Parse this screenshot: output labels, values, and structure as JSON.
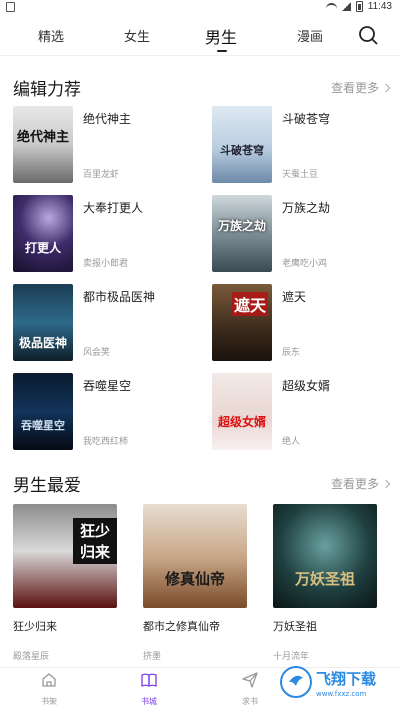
{
  "status_bar": {
    "time": "11:43"
  },
  "tabs": [
    {
      "label": "精选"
    },
    {
      "label": "女生"
    },
    {
      "label": "男生",
      "active": true
    },
    {
      "label": "漫画"
    }
  ],
  "sections": {
    "editor": {
      "title": "编辑力荐",
      "more": "查看更多",
      "books": [
        {
          "title": "绝代神主",
          "author": "百里龙虾",
          "cover_text": "绝代神主"
        },
        {
          "title": "斗破苍穹",
          "author": "天蚕土豆",
          "cover_text": "斗破苍穹"
        },
        {
          "title": "大奉打更人",
          "author": "卖报小郎君",
          "cover_text": "打更人"
        },
        {
          "title": "万族之劫",
          "author": "老鹰吃小鸡",
          "cover_text": "万族之劫"
        },
        {
          "title": "都市极品医神",
          "author": "风会笑",
          "cover_text": "极品医神"
        },
        {
          "title": "遮天",
          "author": "辰东",
          "cover_text": "遮天"
        },
        {
          "title": "吞噬星空",
          "author": "我吃西红柿",
          "cover_text": "吞噬星空"
        },
        {
          "title": "超级女婿",
          "author": "绝人",
          "cover_text": "超级女婿"
        }
      ]
    },
    "male": {
      "title": "男生最爱",
      "more": "查看更多",
      "books": [
        {
          "title": "狂少归来",
          "author": "殿落星辰",
          "cover_text": "狂少归来"
        },
        {
          "title": "都市之修真仙帝",
          "author": "挤墨",
          "cover_text": "修真仙帝"
        },
        {
          "title": "万妖圣祖",
          "author": "十月流年",
          "cover_text": "万妖圣祖"
        }
      ]
    }
  },
  "bottom_nav": [
    {
      "label": "书架",
      "icon": "house-icon"
    },
    {
      "label": "书城",
      "icon": "book-icon",
      "active": true
    },
    {
      "label": "求书",
      "icon": "send-icon"
    }
  ],
  "watermark": {
    "text": "飞翔下载",
    "url": "www.fxxz.com"
  },
  "colors": {
    "accent": "#7b3fe4",
    "muted": "#999999"
  }
}
